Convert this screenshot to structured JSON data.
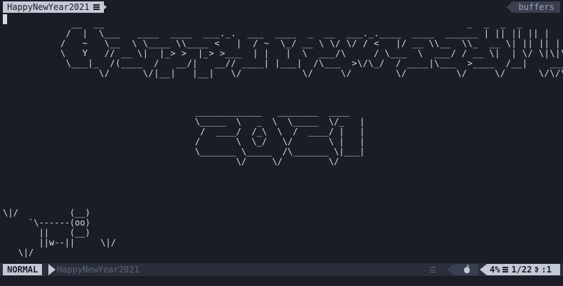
{
  "tabline": {
    "active_tab": "HappyNewYear2021",
    "active_tab_icon": "lines-icon",
    "buffers_label": "buffers"
  },
  "editor": {
    "title_art": "      __  __                                                                  _  _  _  _\n     /  |  \\___   ____  ____  ___._.  ___  ____  _  __  ___._.____  ____  ______ | || || || |\n    /   ~   \\__  \\ \\____ \\\\____ <   |  / ~  \\_/ __ \\ \\/ \\/ / <   |/ __ \\\\__  \\\\_  __ \\| || || || |\n    \\   Y   // __ \\|  |_> >  |_> >___  | |   |  \\  ___/\\     / \\___  \\  ___/ / __ \\|  | \\/ \\|\\|\\|\n     \\___|_  /(____  /   __/|   __// ____| |___|  /\\___  >\\/\\_/  / ____|\\___  >____  /__|    ______\n           \\/      \\/|__|   |__|   \\/           \\/     \\/        \\/         \\/     \\/      \\/\\/\\/",
    "year_art": "_____________   ________  ____\n\\_____  \\   _  \\  \\_____  \\/_   |\n /  ____/  /_\\  \\  /  ____/ |   |\n/       \\  \\_/   \\/       \\ |   |\n\\_______ \\_____  /\\_______ \\|___|\n        \\/     \\/         \\/",
    "cow_art": "\\|/          (__)\n     `\\------(oo)\n       ||    (__)\n       ||w--||     \\|/\n   \\|/"
  },
  "statusline": {
    "mode": "NORMAL",
    "filename": "HappyNewYear2021",
    "format_icon": "lines-icon",
    "os_icon": "apple-icon",
    "percent": "4%",
    "line_icon": "lines-icon",
    "line_position": "1/22",
    "column_icon": "column-icon",
    "column_position": ":1"
  },
  "colors": {
    "background": "#1b1d26",
    "statusline_bg": "#2a2e3b",
    "highlight": "#c3c9d6",
    "muted": "#5c6478",
    "text": "#d8dbe3"
  }
}
